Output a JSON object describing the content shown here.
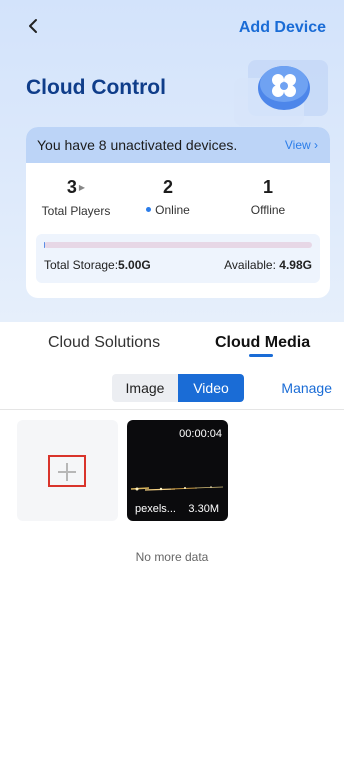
{
  "header": {
    "add_device_label": "Add Device",
    "title": "Cloud Control"
  },
  "banner": {
    "text": "You have 8 unactivated devices.",
    "link": "View"
  },
  "stats": [
    {
      "value": "3",
      "label": "Total Players"
    },
    {
      "value": "2",
      "label": "Online"
    },
    {
      "value": "1",
      "label": "Offline"
    }
  ],
  "storage": {
    "total_label": "Total Storage:",
    "total_value": "5.00G",
    "available_label": "Available:",
    "available_value": "4.98G",
    "used_fraction": 0.004
  },
  "tabs": [
    {
      "label": "Cloud Solutions",
      "active": false
    },
    {
      "label": "Cloud Media",
      "active": true
    }
  ],
  "media_filter": {
    "options": [
      "Image",
      "Video"
    ],
    "selected": "Video",
    "manage_label": "Manage"
  },
  "media_items": [
    {
      "name": "pexels...",
      "size": "3.30M",
      "duration": "00:00:04"
    }
  ],
  "footer_text": "No more data",
  "colors": {
    "accent": "#1a6cd6",
    "title": "#0f3d8a",
    "add_box_border": "#d9342b"
  },
  "icons": {
    "back": "chevron-left-icon",
    "add": "plus-icon",
    "cloud": "cloud-icon"
  }
}
